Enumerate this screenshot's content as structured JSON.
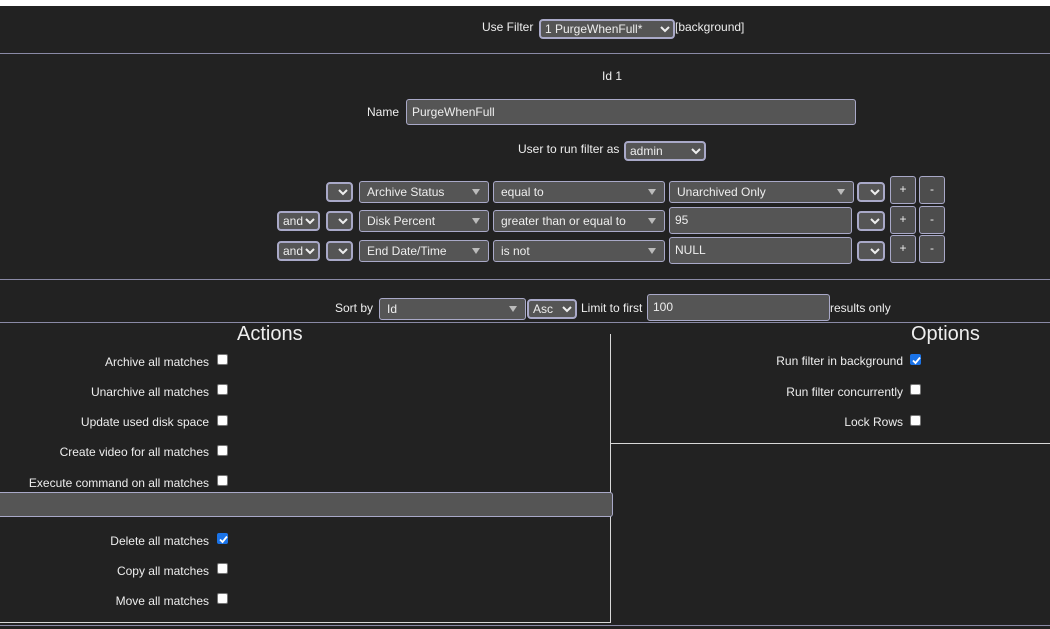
{
  "use_filter": {
    "label": "Use Filter",
    "selected": "1 PurgeWhenFull*",
    "suffix": "[background]"
  },
  "filter": {
    "id_text": "Id 1",
    "name_label": "Name",
    "name_value": "PurgeWhenFull",
    "user_label": "User to run filter as",
    "user_value": "admin"
  },
  "terms": [
    {
      "conjunction": "",
      "open_bracket": "",
      "field": "Archive Status",
      "operator": "equal to",
      "value": "Unarchived Only",
      "value_is_select": true,
      "close_bracket": "",
      "add": "+",
      "remove": "-"
    },
    {
      "conjunction": "and",
      "open_bracket": "",
      "field": "Disk Percent",
      "operator": "greater than or equal to",
      "value": "95",
      "value_is_select": false,
      "close_bracket": "",
      "add": "+",
      "remove": "-"
    },
    {
      "conjunction": "and",
      "open_bracket": "",
      "field": "End Date/Time",
      "operator": "is not",
      "value": "NULL",
      "value_is_select": false,
      "close_bracket": "",
      "add": "+",
      "remove": "-"
    }
  ],
  "sort": {
    "label": "Sort by",
    "field": "Id",
    "direction": "Asc",
    "limit_label": "Limit to first",
    "limit_value": "100",
    "limit_suffix": "results only"
  },
  "actions": {
    "title": "Actions",
    "items": [
      {
        "label": "Archive all matches",
        "checked": false
      },
      {
        "label": "Unarchive all matches",
        "checked": false
      },
      {
        "label": "Update used disk space",
        "checked": false
      },
      {
        "label": "Create video for all matches",
        "checked": false
      },
      {
        "label": "Execute command on all matches",
        "checked": false
      },
      {
        "label": "Delete all matches",
        "checked": true
      },
      {
        "label": "Copy all matches",
        "checked": false
      },
      {
        "label": "Move all matches",
        "checked": false
      }
    ],
    "command_value": ""
  },
  "options": {
    "title": "Options",
    "items": [
      {
        "label": "Run filter in background",
        "checked": true
      },
      {
        "label": "Run filter concurrently",
        "checked": false
      },
      {
        "label": "Lock Rows",
        "checked": false
      }
    ]
  },
  "colors": {
    "background": "#222222",
    "control_bg": "#555555",
    "control_border": "#a9a9c8",
    "checkbox_checked": "#1a73e8"
  }
}
